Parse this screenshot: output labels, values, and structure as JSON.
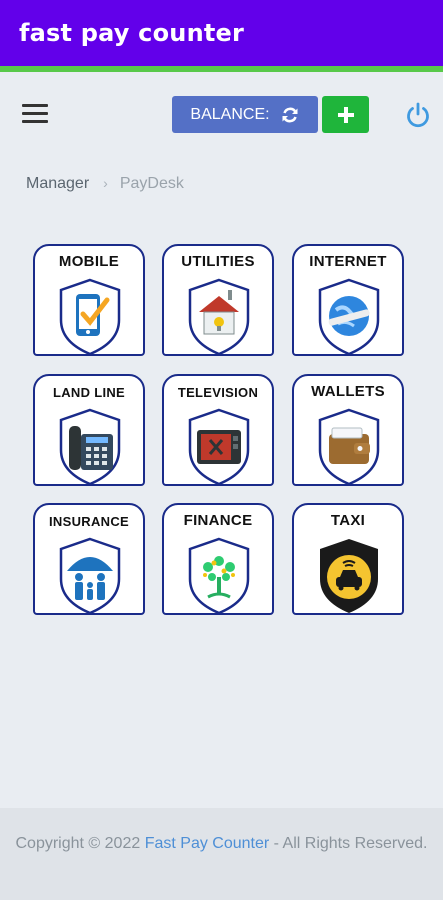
{
  "appbar": {
    "title": "fast pay counter"
  },
  "toolbar": {
    "balance_label": "BALANCE:",
    "icons": {
      "menu": "hamburger-menu-icon",
      "refresh": "refresh-icon",
      "add": "plus-icon",
      "power": "power-icon"
    },
    "colors": {
      "balance_bg": "#5470c6",
      "add_bg": "#1fb53b",
      "power": "#3f9ae0"
    }
  },
  "breadcrumb": {
    "parent": "Manager",
    "separator": "›",
    "current": "PayDesk"
  },
  "services": [
    {
      "label": "MOBILE",
      "icon": "mobile-phone-icon"
    },
    {
      "label": "UTILITIES",
      "icon": "utilities-house-icon"
    },
    {
      "label": "INTERNET",
      "icon": "globe-icon"
    },
    {
      "label": "LAND LINE",
      "icon": "landline-phone-icon"
    },
    {
      "label": "TELEVISION",
      "icon": "television-icon"
    },
    {
      "label": "WALLETS",
      "icon": "wallet-icon"
    },
    {
      "label": "INSURANCE",
      "icon": "family-umbrella-icon"
    },
    {
      "label": "FINANCE",
      "icon": "money-tree-icon"
    },
    {
      "label": "TAXI",
      "icon": "taxi-icon"
    }
  ],
  "footer": {
    "prefix": "Copyright © 2022 ",
    "company": "Fast Pay Counter",
    "suffix": " - All Rights Reserved."
  },
  "theme": {
    "appbar": "#6200ea",
    "appbar_accent": "#58c94a",
    "tile_border": "#1a2b8a"
  }
}
